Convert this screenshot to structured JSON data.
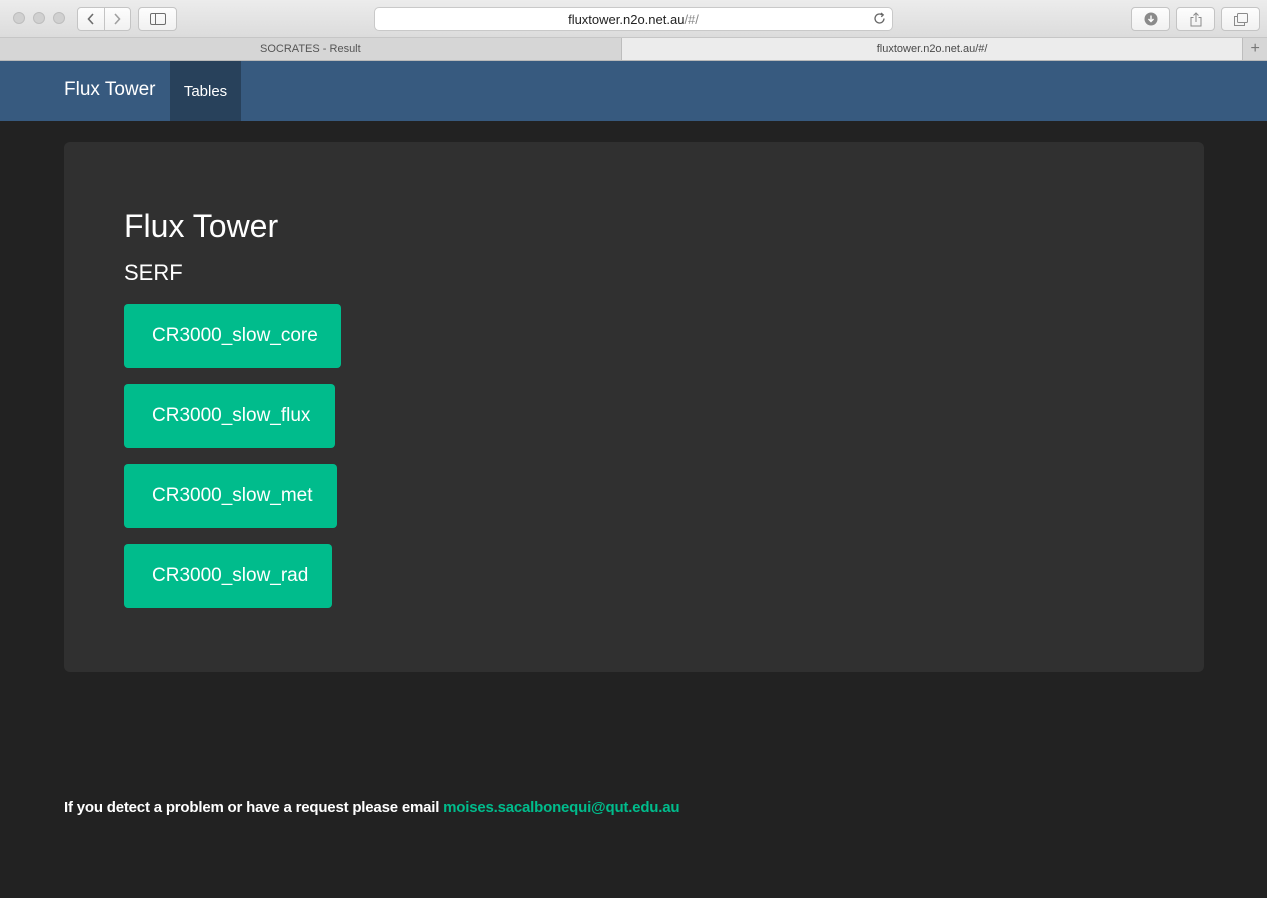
{
  "browser": {
    "url_host": "fluxtower.n2o.net.au",
    "url_path": "/#/",
    "tabs": [
      {
        "title": "SOCRATES - Result",
        "active": false
      },
      {
        "title": "fluxtower.n2o.net.au/#/",
        "active": true
      }
    ],
    "new_tab_icon": "plus-icon"
  },
  "navbar": {
    "brand": "Flux Tower",
    "items": [
      {
        "label": "Tables",
        "active": true
      }
    ],
    "background": "#375a7f"
  },
  "main": {
    "title": "Flux Tower",
    "subtitle": "SERF",
    "buttons": [
      {
        "label": "CR3000_slow_core"
      },
      {
        "label": "CR3000_slow_flux"
      },
      {
        "label": "CR3000_slow_met"
      },
      {
        "label": "CR3000_slow_rad"
      }
    ],
    "button_color": "#00bc8c"
  },
  "footer": {
    "text": "If you detect a problem or have a request please email ",
    "email": "moises.sacalbonequi@qut.edu.au"
  }
}
